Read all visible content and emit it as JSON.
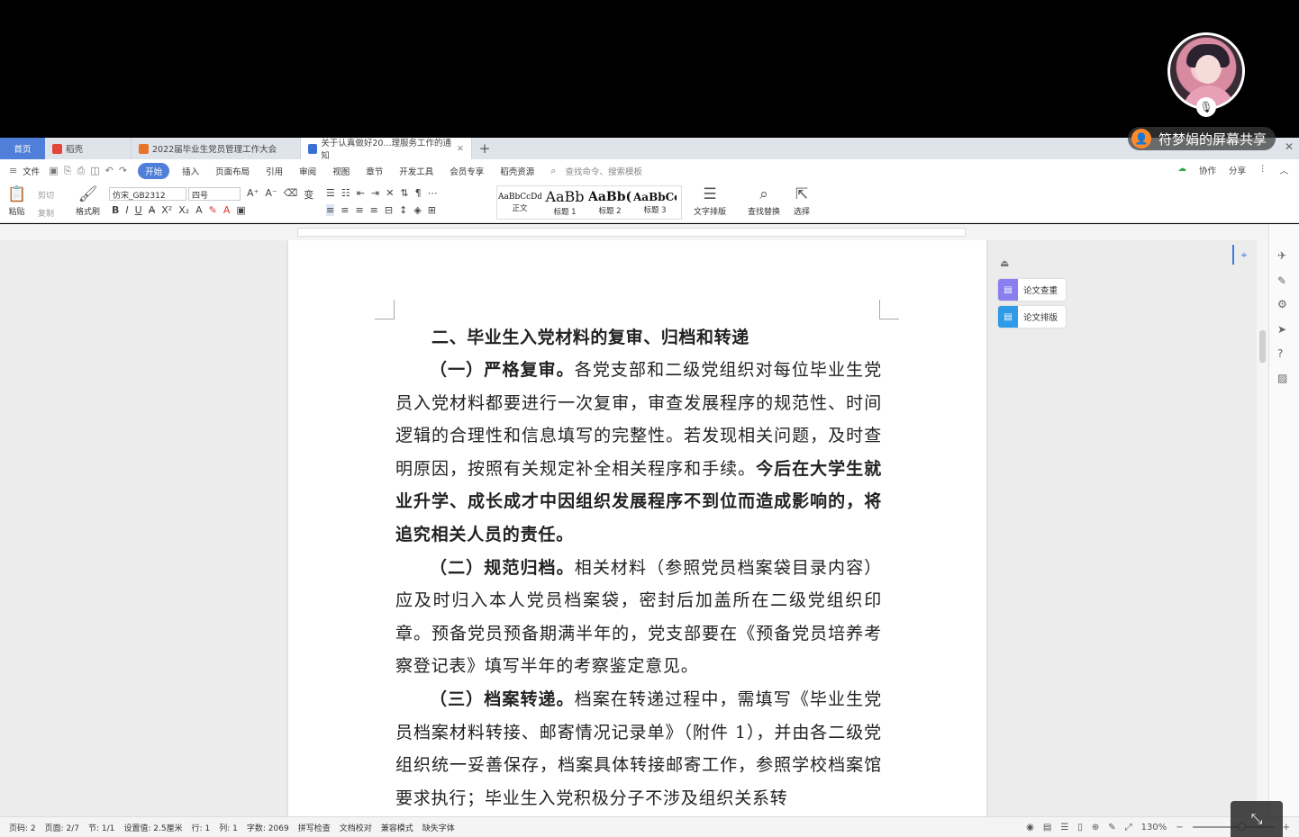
{
  "overlay": {
    "share_label": "符梦娟的屏幕共享"
  },
  "tabs": {
    "home": "首页",
    "items": [
      {
        "label": "稻壳",
        "color": "#e2463a"
      },
      {
        "label": "2022届毕业生党员管理工作大会",
        "color": "#e8742c"
      },
      {
        "label": "关于认真做好20...理服务工作的通知",
        "color": "#3b6fd6"
      }
    ],
    "add": "+"
  },
  "menu": {
    "file": "文件",
    "items": [
      "开始",
      "插入",
      "页面布局",
      "引用",
      "审阅",
      "视图",
      "章节",
      "开发工具",
      "会员专享",
      "稻壳资源"
    ],
    "search_placeholder": "查找命令、搜索模板",
    "right": [
      "协作",
      "分享"
    ]
  },
  "ribbon": {
    "paste": "粘贴",
    "cut": "剪切",
    "copy": "复制",
    "format_painter": "格式刷",
    "font_name": "仿宋_GB2312",
    "font_size": "四号",
    "styles": [
      {
        "sample": "AaBbCcDd",
        "name": "正文"
      },
      {
        "sample": "AaBb",
        "name": "标题 1"
      },
      {
        "sample": "AaBb(",
        "name": "标题 2"
      },
      {
        "sample": "AaBbCc",
        "name": "标题 3"
      }
    ],
    "text_layout": "文字排版",
    "find_replace": "查找替换",
    "select": "选择"
  },
  "document": {
    "heading": "二、毕业生入党材料的复审、归档和转递",
    "p1_bold": "（一）严格复审。",
    "p1_text": "各党支部和二级党组织对每位毕业生党员入党材料都要进行一次复审，审查发展程序的规范性、时间逻辑的合理性和信息填写的完整性。若发现相关问题，及时查明原因，按照有关规定补全相关程序和手续。",
    "p1_bold_end": "今后在大学生就业升学、成长成才中因组织发展程序不到位而造成影响的，将追究相关人员的责任。",
    "p2_bold": "（二）规范归档。",
    "p2_text": "相关材料（参照党员档案袋目录内容）应及时归入本人党员档案袋，密封后加盖所在二级党组织印章。预备党员预备期满半年的，党支部要在《预备党员培养考察登记表》填写半年的考察鉴定意见。",
    "p3_bold": "（三）档案转递。",
    "p3_text": "档案在转递过程中，需填写《毕业生党员档案材料转接、邮寄情况记录单》（附件 1），并由各二级党组织统一妥善保存，档案具体转接邮寄工作，参照学校档案馆要求执行；毕业生入党积极分子不涉及组织关系转"
  },
  "side_tools": [
    "论文查重",
    "论文排版"
  ],
  "status": {
    "items": [
      "页码: 2",
      "页面: 2/7",
      "节: 1/1",
      "设置值: 2.5厘米",
      "行: 1",
      "列: 1",
      "字数: 2069",
      "拼写检查",
      "文档校对",
      "兼容模式",
      "缺失字体"
    ],
    "zoom": "130%"
  }
}
